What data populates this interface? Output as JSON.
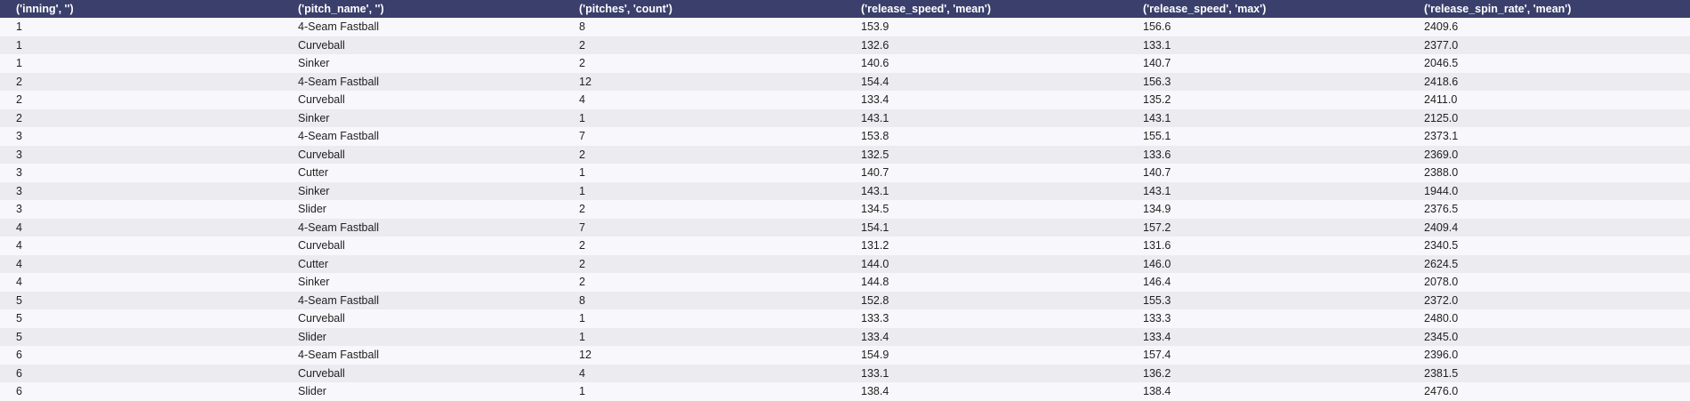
{
  "table": {
    "columns": [
      "('inning', '')",
      "('pitch_name', '')",
      "('pitches', 'count')",
      "('release_speed', 'mean')",
      "('release_speed', 'max')",
      "('release_spin_rate', 'mean')"
    ],
    "rows": [
      [
        "1",
        "4-Seam Fastball",
        "8",
        "153.9",
        "156.6",
        "2409.6"
      ],
      [
        "1",
        "Curveball",
        "2",
        "132.6",
        "133.1",
        "2377.0"
      ],
      [
        "1",
        "Sinker",
        "2",
        "140.6",
        "140.7",
        "2046.5"
      ],
      [
        "2",
        "4-Seam Fastball",
        "12",
        "154.4",
        "156.3",
        "2418.6"
      ],
      [
        "2",
        "Curveball",
        "4",
        "133.4",
        "135.2",
        "2411.0"
      ],
      [
        "2",
        "Sinker",
        "1",
        "143.1",
        "143.1",
        "2125.0"
      ],
      [
        "3",
        "4-Seam Fastball",
        "7",
        "153.8",
        "155.1",
        "2373.1"
      ],
      [
        "3",
        "Curveball",
        "2",
        "132.5",
        "133.6",
        "2369.0"
      ],
      [
        "3",
        "Cutter",
        "1",
        "140.7",
        "140.7",
        "2388.0"
      ],
      [
        "3",
        "Sinker",
        "1",
        "143.1",
        "143.1",
        "1944.0"
      ],
      [
        "3",
        "Slider",
        "2",
        "134.5",
        "134.9",
        "2376.5"
      ],
      [
        "4",
        "4-Seam Fastball",
        "7",
        "154.1",
        "157.2",
        "2409.4"
      ],
      [
        "4",
        "Curveball",
        "2",
        "131.2",
        "131.6",
        "2340.5"
      ],
      [
        "4",
        "Cutter",
        "2",
        "144.0",
        "146.0",
        "2624.5"
      ],
      [
        "4",
        "Sinker",
        "2",
        "144.8",
        "146.4",
        "2078.0"
      ],
      [
        "5",
        "4-Seam Fastball",
        "8",
        "152.8",
        "155.3",
        "2372.0"
      ],
      [
        "5",
        "Curveball",
        "1",
        "133.3",
        "133.3",
        "2480.0"
      ],
      [
        "5",
        "Slider",
        "1",
        "133.4",
        "133.4",
        "2345.0"
      ],
      [
        "6",
        "4-Seam Fastball",
        "12",
        "154.9",
        "157.4",
        "2396.0"
      ],
      [
        "6",
        "Curveball",
        "4",
        "133.1",
        "136.2",
        "2381.5"
      ],
      [
        "6",
        "Slider",
        "1",
        "138.4",
        "138.4",
        "2476.0"
      ]
    ]
  }
}
